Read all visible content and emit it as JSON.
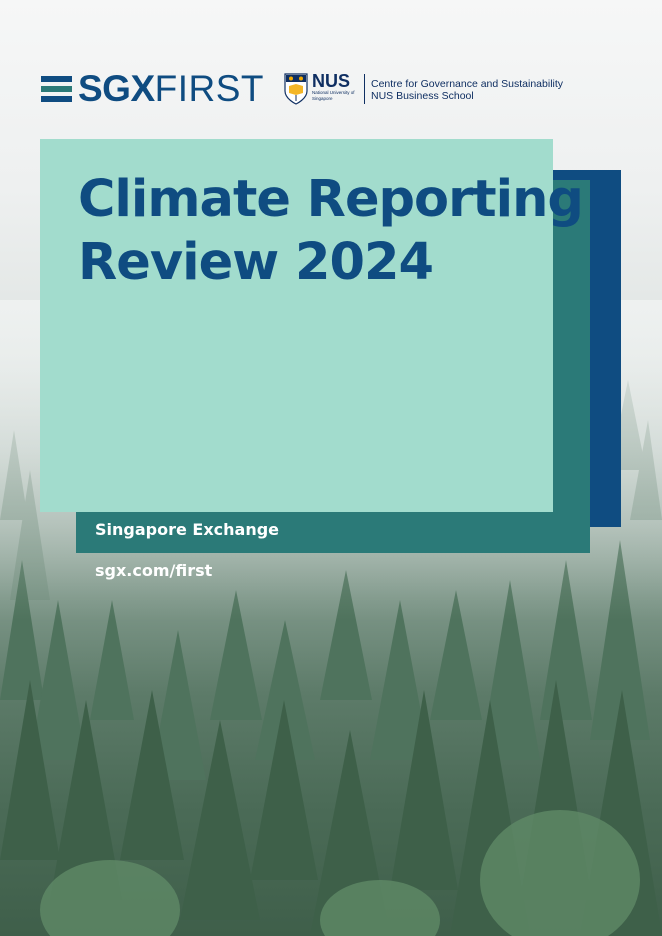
{
  "header": {
    "sgx_logo": {
      "bold": "SGX",
      "light": "FIRST"
    },
    "nus_logo": {
      "name": "NUS",
      "subtext": "National University of Singapore",
      "centre_line1": "Centre for Governance and Sustainability",
      "centre_line2": "NUS Business School"
    }
  },
  "cover": {
    "title_line1": "Climate Reporting",
    "title_line2": "Review 2024",
    "organisation": "Singapore Exchange",
    "url": "sgx.com/first"
  },
  "colors": {
    "navy": "#0f4c81",
    "teal": "#2b7a78",
    "mint": "#a2dccd",
    "forest": "#4b6b57"
  }
}
